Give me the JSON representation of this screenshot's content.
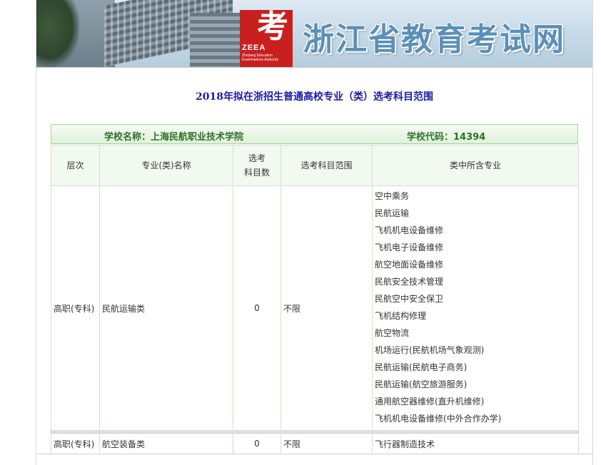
{
  "banner": {
    "site_title": "浙江省教育考试网",
    "logo_glyph": "考",
    "logo_text": "ZEEA",
    "logo_subtext": "Zhejiang Education Examinations Authority"
  },
  "page_title": "2018年拟在浙招生普通高校专业（类）选考科目范围",
  "school": {
    "name_label": "学校名称：上海民航职业技术学院",
    "code_label": "学校代码：14394"
  },
  "table": {
    "headers": {
      "level": "层次",
      "major": "专业(类)名称",
      "count_line1": "选考",
      "count_line2": "科目数",
      "range": "选考科目范围",
      "included": "类中所含专业"
    },
    "rows": [
      {
        "level": "高职(专科)",
        "major": "民航运输类",
        "count": "0",
        "range": "不限",
        "included": [
          "空中乘务",
          "民航运输",
          "飞机机电设备维修",
          "飞机电子设备维修",
          "航空地面设备维修",
          "民航安全技术管理",
          "民航空中安全保卫",
          "飞机结构修理",
          "航空物流",
          "机场运行(民航机场气象观测)",
          "民航运输(民航电子商务)",
          "民航运输(航空旅游服务)",
          "通用航空器维修(直升机维修)",
          "飞机机电设备维修(中外合作办学)"
        ]
      },
      {
        "level": "高职(专科)",
        "major": "航空装备类",
        "count": "0",
        "range": "不限",
        "included": [
          "飞行器制造技术"
        ]
      }
    ]
  }
}
